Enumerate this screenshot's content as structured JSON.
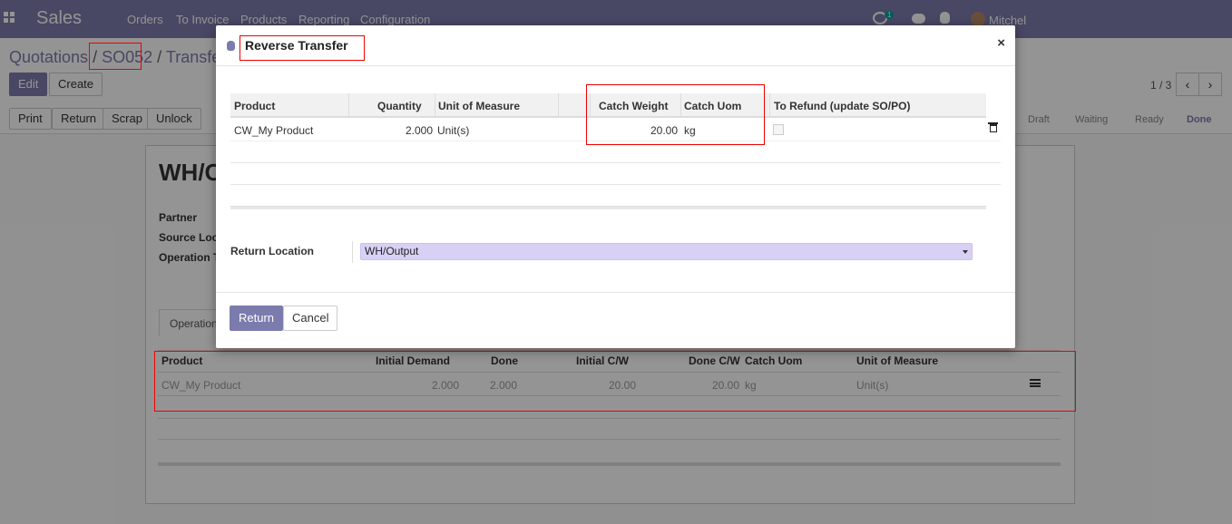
{
  "navbar": {
    "app_name": "Sales",
    "menu": [
      "Orders",
      "To Invoice",
      "Products",
      "Reporting",
      "Configuration"
    ],
    "activity_count": "1",
    "user_name": "Mitchel"
  },
  "breadcrumb": {
    "part1": "Quotations",
    "sep": "/",
    "part2": "SO052",
    "part3": "Transfers"
  },
  "control": {
    "edit": "Edit",
    "create": "Create",
    "pager": "1 / 3",
    "prev": "‹",
    "next": "›",
    "actions": [
      "Print",
      "Return",
      "Scrap",
      "Unlock"
    ],
    "stages": [
      "Draft",
      "Waiting",
      "Ready",
      "Done"
    ]
  },
  "sheet": {
    "title": "WH/O",
    "labels": [
      "Partner",
      "Source Loca",
      "Operation T"
    ],
    "tab": "Operations"
  },
  "bg_table": {
    "headers": [
      "Product",
      "Initial Demand",
      "Done",
      "Initial C/W",
      "Done C/W",
      "Catch Uom",
      "Unit of Measure"
    ],
    "row": [
      "CW_My Product",
      "2.000",
      "2.000",
      "20.00",
      "20.00",
      "kg",
      "Unit(s)"
    ]
  },
  "modal": {
    "title": "Reverse Transfer",
    "close": "×",
    "table": {
      "headers": [
        "Product",
        "Quantity",
        "Unit of Measure",
        "Catch Weight",
        "Catch Uom",
        "To Refund (update SO/PO)"
      ],
      "row": {
        "product": "CW_My Product",
        "quantity": "2.000",
        "uom": "Unit(s)",
        "catch_weight": "20.00",
        "catch_uom": "kg",
        "to_refund": false
      }
    },
    "return_location_label": "Return Location",
    "return_location_value": "WH/Output",
    "return_button": "Return",
    "cancel_button": "Cancel"
  },
  "colors": {
    "brand": "#7c7bad",
    "annotation": "#e00000",
    "select_bg": "#d9d1f5"
  }
}
